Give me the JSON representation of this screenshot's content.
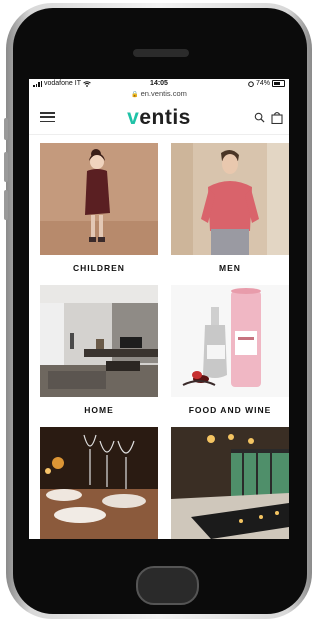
{
  "status_bar": {
    "carrier": "vodafone IT",
    "time": "14:05",
    "battery": "74%"
  },
  "url_bar": {
    "url": "en.ventis.com"
  },
  "header": {
    "logo": "ventis",
    "menu_icon": "hamburger-icon",
    "search_icon": "search-icon",
    "bag_icon": "shopping-bag-icon"
  },
  "categories": [
    {
      "label": "CHILDREN"
    },
    {
      "label": "MEN"
    },
    {
      "label": "HOME"
    },
    {
      "label": "FOOD AND WINE"
    },
    {
      "label": ""
    },
    {
      "label": ""
    }
  ],
  "colors": {
    "brand_accent": "#1fc2a7",
    "text": "#111111",
    "phone_body": "#0b0b0b"
  }
}
